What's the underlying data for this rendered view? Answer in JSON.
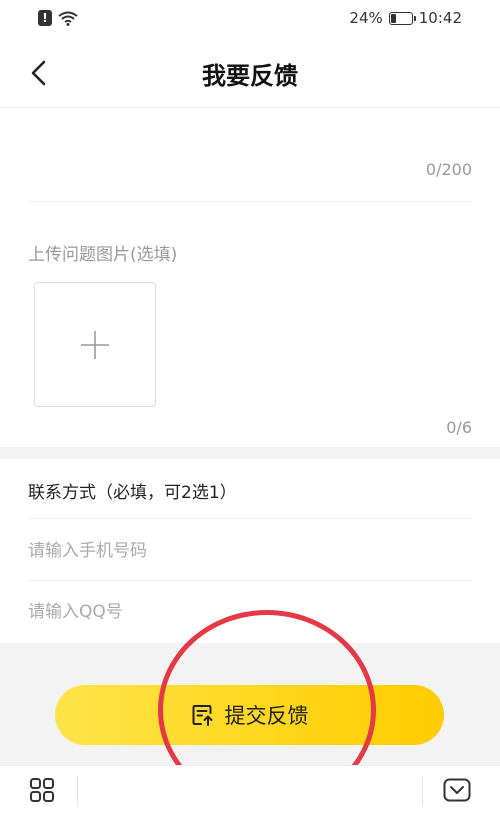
{
  "status_bar": {
    "battery_level": "24%",
    "battery_fraction": 0.24,
    "time": "10:42",
    "icons": [
      "sim-alert-icon",
      "wifi-icon",
      "battery-icon"
    ]
  },
  "header": {
    "title": "我要反馈",
    "back_icon": "chevron-left-icon"
  },
  "feedback": {
    "description_value": "",
    "char_count": "0/200"
  },
  "images": {
    "label": "上传问题图片(选填)",
    "add_icon": "plus-icon",
    "count": "0/6"
  },
  "contact": {
    "title": "联系方式（必填，可2选1）",
    "phone_placeholder": "请输入手机号码",
    "qq_placeholder": "请输入QQ号"
  },
  "submit": {
    "label": "提交反馈",
    "icon": "edit-upload-icon",
    "background": "#ffd71d"
  },
  "annotation": {
    "color": "#e33a45"
  },
  "bottom_bar": {
    "menu_icon": "grid-icon",
    "collapse_icon": "collapse-down-icon"
  }
}
